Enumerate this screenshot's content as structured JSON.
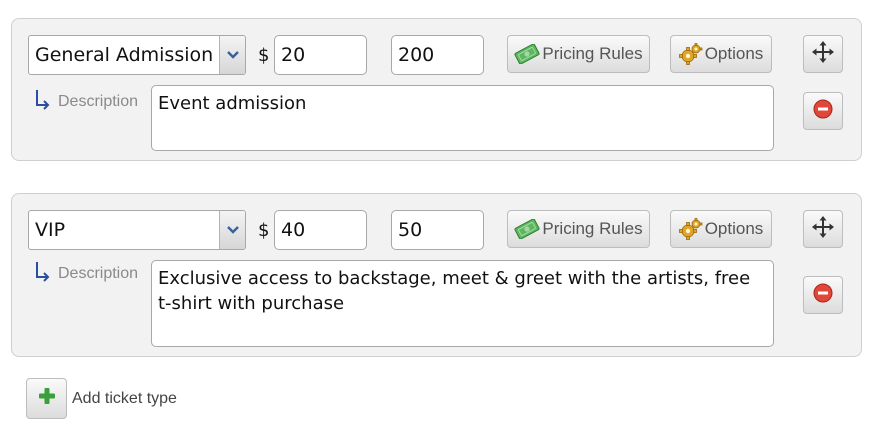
{
  "tickets": [
    {
      "type": "General Admission",
      "currency": "$",
      "price": "20",
      "quantity": "200",
      "pricing_rules_label": "Pricing Rules",
      "options_label": "Options",
      "description_label": "Description",
      "description": "Event admission"
    },
    {
      "type": "VIP",
      "currency": "$",
      "price": "40",
      "quantity": "50",
      "pricing_rules_label": "Pricing Rules",
      "options_label": "Options",
      "description_label": "Description",
      "description": "Exclusive access to backstage, meet & greet with the artists, free t-shirt with purchase"
    }
  ],
  "add_ticket_label": "Add ticket type",
  "colors": {
    "panel_bg": "#f2f2f2",
    "panel_border": "#cfcfcf",
    "money_green": "#4caf50",
    "remove_red": "#d9463a",
    "add_green": "#3aa13a",
    "arrow_blue": "#2a4ea0"
  },
  "icons": {
    "select_arrow": "chevron-down-icon",
    "pricing": "money-icon",
    "options": "gear-icon",
    "move": "move-icon",
    "remove": "remove-icon",
    "description": "return-arrow-icon",
    "add": "plus-icon"
  }
}
